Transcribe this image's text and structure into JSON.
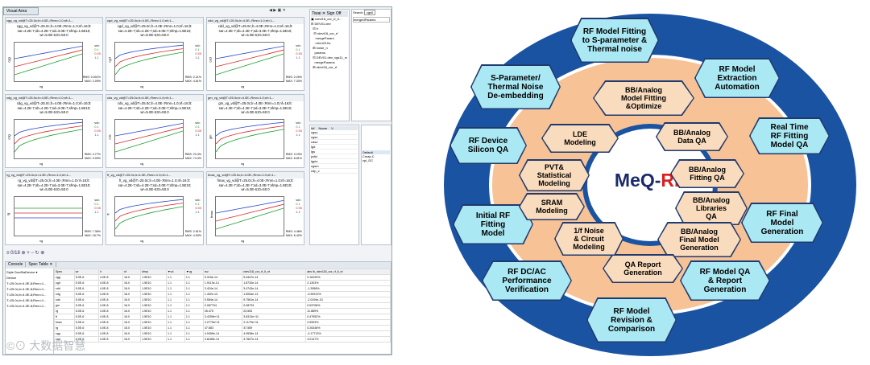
{
  "left_app": {
    "view_tab": "Visual Area",
    "nav": "◀ ▶ ▣ ✕",
    "panels": [
      {
        "title": "cgg_vg_vd@T=25.0c;lr=4.0E-;Rmn=1.0;nf=1-..",
        "l1": "cgg_vg_vd@T=25.0c;lr=4.0E-;Rmn=1.0;nf=16;lt:",
        "l2": "sar=4.2E-7;sb=4.2E-7;sd=3.0E-7;sfmp=1.5E10;",
        "l3": "wr=5.0E-6;t0=50.0",
        "yl": "cgg",
        "legend": [
          "vd=",
          "0.1",
          "0.55",
          "1.1"
        ],
        "rms": [
          "RMS: 0.001%",
          "MAX: 2.09%"
        ]
      },
      {
        "title": "cgd_vg_vd@T=25.0c;lr=4.0E-;Rmn=1.0;nf=1-..",
        "l1": "cgd_vg_vd@T=25.0c;lr=4.0E-;Rmn=1.0;nf=16;lt:",
        "l2": "sar=4.2E-7;sb=4.2E-7;sd=3.0E-7;sfmp=1.5E10;",
        "l3": "wr=5.0E-6;t0=50.0",
        "yl": "cgd",
        "legend": [
          "vd=",
          "0.1",
          "0.55",
          "1.1"
        ],
        "rms": [
          "RMS: 2.21%",
          "MAX: 4.61%"
        ]
      },
      {
        "title": "cdd_vg_vd@T=25.0c;lr=4.0E-;Rmn=1.0;nf=1-..",
        "l1": "cdd_vg_vd@T=25.0c;lr=4.0E-;Rmn=1.0;nf=16;lt:",
        "l2": "sar=4.2E-7;sb=4.2E-7;sd=3.0E-7;sfmp=1.5E10;",
        "l3": "wr=5.0E-6;t0=50.0",
        "yl": "cdd",
        "legend": [
          "vd=",
          "0.1",
          "0.55",
          "1.1"
        ],
        "rms": [
          "RMS: 2.09%",
          "MAX: 7.30%"
        ]
      },
      {
        "title": "cdg_vg_vd@T=25.0c;lr=4.0E-;Rmn=1.0;nf=1-..",
        "l1": "cdg_vg_vd@T=25.0c;lr=4.0E-;Rmn=1.0;nf=16;lt:",
        "l2": "sar=4.2E-7;sb=4.2E-7;sd=3.0E-7;sfmp=1.5E10;",
        "l3": "wr=5.0E-6;t0=50.0",
        "yl": "cdg",
        "legend": [
          "vd=",
          "0.1",
          "0.55",
          "1.1"
        ],
        "rms": [
          "RMS: 4.77%",
          "MAX: 9.09%"
        ]
      },
      {
        "title": "cds_vg_vd@T=25.0c;lr=4.0E-;Rmn=1.0;nf=1-..",
        "l1": "cds_vg_vd@T=25.0c;lr=4.0E-;Rmn=1.0;nf=16;lt:",
        "l2": "sar=4.2E-7;sb=4.2E-7;sd=3.0E-7;sfmp=1.5E10;",
        "l3": "wr=5.0E-6;t0=50.0",
        "yl": "cds",
        "legend": [
          "vd=",
          "0.1",
          "0.55",
          "1.1"
        ],
        "rms": [
          "RMS: 23.4%",
          "MAX: 74.4%"
        ]
      },
      {
        "title": "gm_vg_vd@T=25.0c;lr=4.0E-;Rmn=1.0;nf=1-..",
        "l1": "gm_vg_vd@T=25.0c;lr=4.0E-;Rmn=1.0;nf=16;lt:",
        "l2": "sar=4.2E-7;sb=4.2E-7;sd=3.0E-7;sfmp=1.5E10;",
        "l3": "wr=5.0E-6;t0=50.0",
        "yl": "gm",
        "legend": [
          "vd=",
          "0.1",
          "0.55",
          "1.1"
        ],
        "rms": [
          "RMS: 3.29%",
          "MAX: 8.81%"
        ]
      },
      {
        "title": "rg_vg_vd@T=25.0c;lr=4.0E-;Rmn=1.0;nf=1-..",
        "l1": "rg_vg_vd@T=25.0c;lr=4.0E-;Rmn=1.0;nf=16;lt:",
        "l2": "sar=4.2E-7;sb=4.2E-7;sd=3.0E-7;sfmp=1.5E10;",
        "l3": "wr=5.0E-6;t0=50.0",
        "yl": "rg",
        "legend": [
          "vd=",
          "0.1",
          "0.55",
          "1.1"
        ],
        "rms": [
          "RMS: 7.36%",
          "MAX: 18.7%"
        ]
      },
      {
        "title": "ft_vg_vd@T=25.0c;lr=4.0E-;Rmn=1.0;nf=1-..",
        "l1": "ft_vg_vd@T=25.0c;lr=4.0E-;Rmn=1.0;nf=16;lt:",
        "l2": "sar=4.2E-7;sb=4.2E-7;sd=3.0E-7;sfmp=1.5E10;",
        "l3": "wr=5.0E-6;t0=50.0",
        "yl": "ft",
        "legend": [
          "vd=",
          "0.1",
          "0.55",
          "1.1"
        ],
        "rms": [
          "RMS: 2.61%",
          "MAX: 4.53%"
        ]
      },
      {
        "title": "fmax_vg_vd@T=25.0c;lr=4.0E-;Rmn=1.0;nf=1-..",
        "l1": "fmax_vg_vd@T=25.0c;lr=4.0E-;Rmn=1.0;nf=16;lt:",
        "l2": "sar=4.2E-7;sb=4.2E-7;sd=3.0E-7;sfmp=1.5E10;",
        "l3": "wr=5.0E-6;t0=50.0",
        "yl": "fmax",
        "legend": [
          "vd=",
          "0.1",
          "0.55",
          "1.1"
        ],
        "rms": [
          "RMS: 4.48%",
          "MAX: 6.42%"
        ]
      }
    ],
    "xlabel": "vg",
    "toolbar2": "≡ 0/18 ⊕ + − ↻ ⊗",
    "tree_header": "Tiwai ✕ Sign Off",
    "tree_items": [
      "▣ rdevl18_cor_rf_lt...",
      "⊟ DEV01.dev",
      "  ⊟ lr",
      "   ⊟ rdevl18_cor_rf",
      "     mergeParam",
      "     rohm23.fw",
      "  ⊞ noise_n",
      "    params",
      "  ⊟ DEV01.dev_vgs11_rv",
      "    mergeParams",
      "  ⊞ rdevl18_cor_rf"
    ],
    "search_label": "Search",
    "search_value": "cgs0",
    "merge_label": "mergedParams",
    "params_header": [
      "Idf",
      "Name",
      "V"
    ],
    "params_rows": [
      "cgso",
      "cgso",
      "caso",
      "lgd",
      "lgs",
      "pdtd",
      "lgpio",
      "cgsm",
      "cdp_c"
    ],
    "default_label": "Default",
    "default_items": [
      "Cmap.C",
      "xpi_DC"
    ],
    "console_tabs": [
      "Console",
      "Spec Table ✕"
    ],
    "console_left": [
      "Style Doc/BaDevice ▾",
      "Device",
      "T=25.0c;lr=4.0E-8;Rmn=1...",
      "T=25.0c;lr=4.0E-8;Rmn=1...",
      "T=25.0c;lr=4.0E-8;Rmn=1...",
      "T=25.0c;lr=4.0E-8;Rmn=1...",
      "T=25.0c;lr=4.0E-8;Rmn=1..."
    ],
    "table_headers": [
      "Spec",
      "wr",
      "lr",
      "nf",
      "sfmp",
      "▼vd",
      "▼vg",
      "rsv",
      "rdev118_cor_rf_lt_nt",
      "abs lb_rdev118_cor_rf_lt_nt"
    ],
    "table_rows": [
      [
        "cgg",
        "5.0E-6",
        "4.0E-8",
        "16.0",
        "1.5E10",
        "1.1",
        "1.1",
        "5.315e-14",
        "5.3447e-14",
        "0.18193%"
      ],
      [
        "cgd",
        "5.0E-6",
        "4.0E-8",
        "16.0",
        "1.5E10",
        "1.1",
        "1.1",
        "1.9113e-14",
        "1.8733e-14",
        "2.1303%"
      ],
      [
        "cdd",
        "5.0E-6",
        "4.0E-8",
        "16.0",
        "1.5E10",
        "1.1",
        "1.1",
        "3.424e-14",
        "3.4743e-14",
        "-1.3958%"
      ],
      [
        "cdg",
        "5.0E-6",
        "4.0E-8",
        "16.0",
        "1.5E10",
        "1.1",
        "1.1",
        "1.492e-13",
        "1.5054e-13",
        "-0.90912%"
      ],
      [
        "cds",
        "5.0E-6",
        "4.0E-8",
        "16.0",
        "1.5E10",
        "1.1",
        "1.1",
        "9.554e-14",
        "9.7561e-14",
        "-2.0194e-15"
      ],
      [
        "gm",
        "5.0E-6",
        "4.0E-8",
        "16.0",
        "1.5E10",
        "1.1",
        "1.1",
        "0.087704",
        "0.08733",
        "0.53708%"
      ],
      [
        "rg",
        "5.0E-6",
        "4.0E-8",
        "16.0",
        "1.5E10",
        "1.1",
        "1.1",
        "26.475",
        "23.553",
        "11.889%"
      ],
      [
        "ft",
        "5.0E-6",
        "4.0E-8",
        "16.0",
        "1.5E10",
        "1.1",
        "1.1",
        "3.4255e+11",
        "3.6313e+11",
        "0.47952%"
      ],
      [
        "fmax",
        "5.0E-6",
        "4.0E-8",
        "16.0",
        "1.5E10",
        "1.1",
        "1.1",
        "2.2775e+11",
        "2.1179e+11",
        "4.9993%"
      ],
      [
        "rg",
        "5.0E-6",
        "4.0E-8",
        "16.0",
        "1.5E10",
        "1.1",
        "1.1",
        "47.683",
        "47.559",
        "0.26346%"
      ],
      [
        "cgg",
        "5.0E-6",
        "4.0E-8",
        "16.0",
        "1.5E10",
        "1.1",
        "1.1",
        "4.9455e-14",
        "4.9538e-14",
        "-0.17713%"
      ],
      [
        "cgd",
        "5.0E-6",
        "4.0E-8",
        "16.0",
        "1.5E10",
        "1.1",
        "1.1",
        "3.8185e-14",
        "3.7607e-14",
        "4.0147%"
      ]
    ],
    "watermark": "©⊙ 大数据智慧"
  },
  "diagram": {
    "center_a": "MeQ-",
    "center_b": "RF",
    "outer": [
      "RF Model Fitting\nto S-parameter &\nThermal noise",
      "RF Model\nExtraction\nAutomation",
      "Real Time\nRF Fitting\nModel QA",
      "RF Final\nModel\nGeneration",
      "RF Model QA\n& Report\nGeneration",
      "RF Model\nRevision &\nComparison",
      "RF DC/AC\nPerformance\nVerification",
      "Initial RF\nFitting\nModel",
      "RF Device\nSilicon QA",
      "S-Parameter/\nThermal Noise\nDe-embedding"
    ],
    "inner": [
      "BB/Analog\nModel Fitting\n&Optimize",
      "BB/Analog\nData QA",
      "BB/Analog\nFitting QA",
      "BB/Analog\nLibraries\nQA",
      "BB/Analog\nFinal Model\nGeneration",
      "QA Report\nGeneration",
      "1/f Noise\n& Circuit\nModeling",
      "SRAM\nModeling",
      "PVT&\nStatistical\nModeling",
      "LDE\nModeling"
    ],
    "colors": {
      "outer_ring": "#1b53a3",
      "inner_ring": "#f7c296",
      "hex_outer": "#aae8f3",
      "hex_inner": "#f9dbbd",
      "center_meq": "#1b2a6b",
      "center_rf": "#d8201f"
    }
  }
}
